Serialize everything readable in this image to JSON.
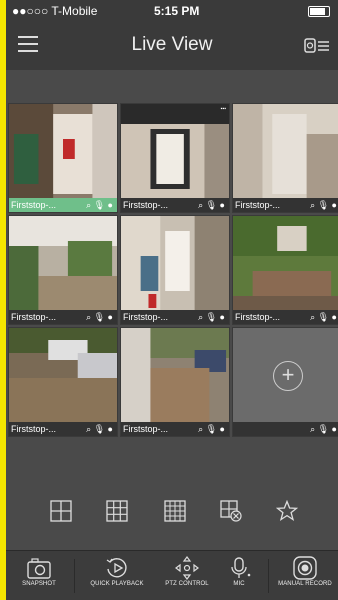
{
  "status_bar": {
    "carrier": "●●○○○ T-Mobile",
    "time": "5:15 PM"
  },
  "nav": {
    "title": "Live View"
  },
  "tiles": [
    {
      "name": "Firststop-...",
      "active": true
    },
    {
      "name": "Firststop-...",
      "active": false
    },
    {
      "name": "Firststop-...",
      "active": false
    },
    {
      "name": "Firststop-...",
      "active": false
    },
    {
      "name": "Firststop-...",
      "active": false
    },
    {
      "name": "Firststop-...",
      "active": false
    },
    {
      "name": "Firststop-...",
      "active": false
    },
    {
      "name": "Firststop-...",
      "active": false
    },
    {
      "name": "",
      "active": false,
      "empty": true
    }
  ],
  "toolbar": {
    "snapshot": "SNAPSHOT",
    "quick_playback": "QUICK PLAYBACK",
    "ptz_control": "PTZ CONTROL",
    "mic": "MIC",
    "manual_record": "MANUAL RECORD"
  },
  "colors": {
    "active_bar": "#6fbf8a",
    "frame": "#f5e600"
  }
}
